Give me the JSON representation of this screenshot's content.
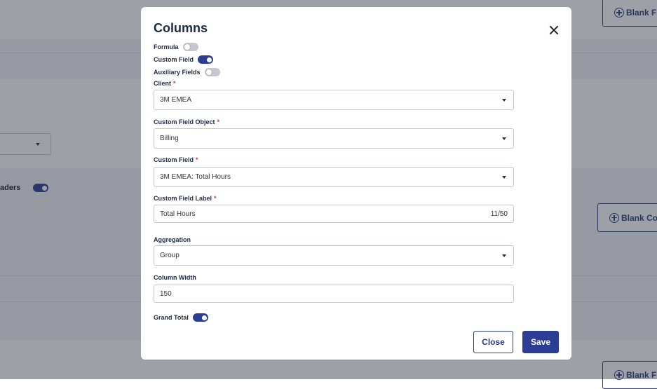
{
  "background": {
    "toggle_label_partial": "aders",
    "blank_field_top": "Blank Fi",
    "blank_column": "Blank Col",
    "blank_field_bottom": "Blank Fi"
  },
  "modal": {
    "title": "Columns",
    "toggles": {
      "formula": {
        "label": "Formula",
        "on": false
      },
      "custom_field": {
        "label": "Custom Field",
        "on": true
      },
      "auxiliary_fields": {
        "label": "Auxiliary Fields",
        "on": false
      },
      "grand_total": {
        "label": "Grand Total",
        "on": true
      }
    },
    "fields": {
      "client": {
        "label": "Client",
        "required": "*",
        "value": "3M EMEA"
      },
      "custom_field_object": {
        "label": "Custom Field Object",
        "required": "*",
        "value": "Billing"
      },
      "custom_field": {
        "label": "Custom Field",
        "required": "*",
        "value": "3M EMEA: Total Hours"
      },
      "custom_field_label": {
        "label": "Custom Field Label",
        "required": "*",
        "value": "Total Hours",
        "counter": "11/50"
      },
      "aggregation": {
        "label": "Aggregation",
        "value": "Group"
      },
      "column_width": {
        "label": "Column Width",
        "value": "150"
      }
    },
    "buttons": {
      "close": "Close",
      "save": "Save"
    }
  },
  "colors": {
    "accent": "#2c3e94",
    "required": "#d23c3c"
  }
}
